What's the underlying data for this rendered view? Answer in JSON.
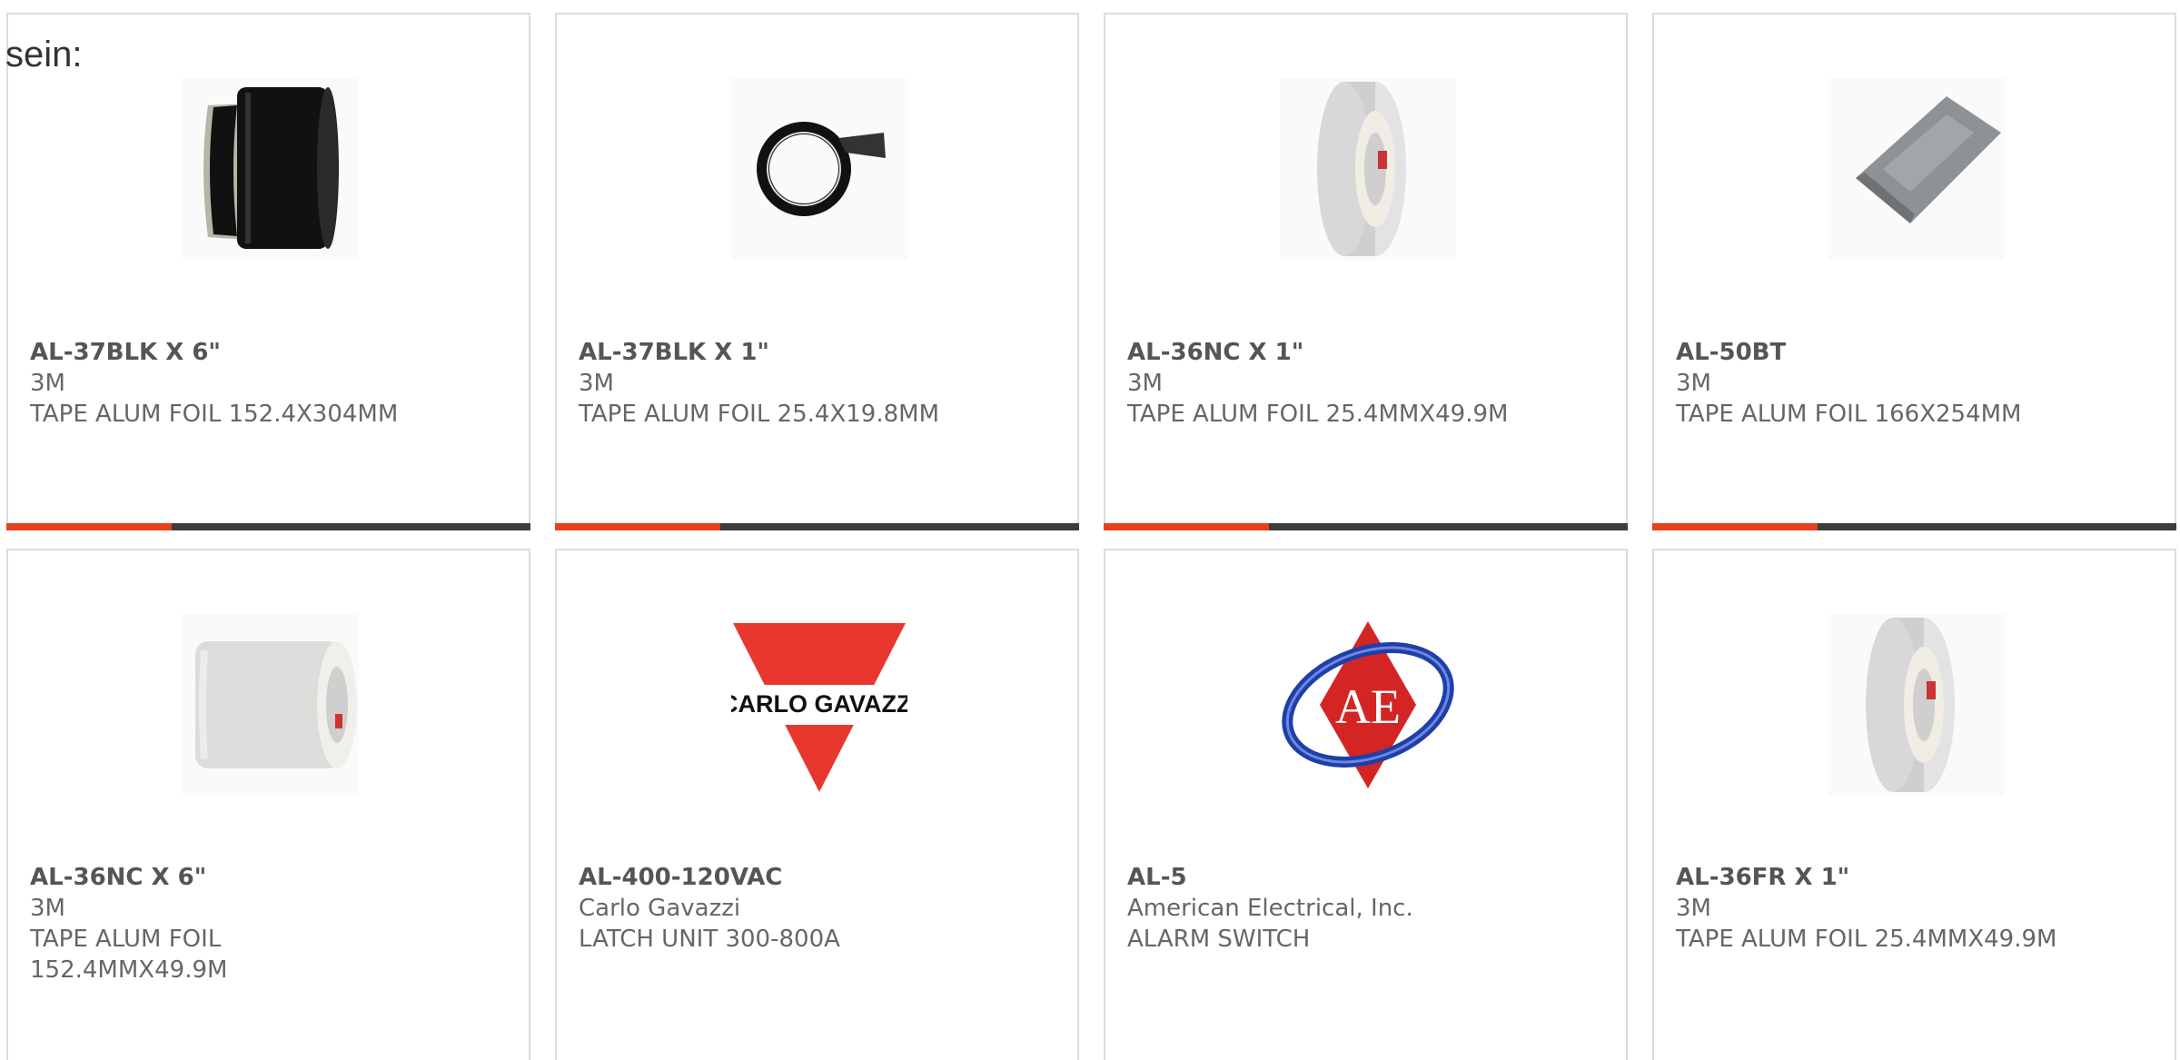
{
  "intro_text": "sein:",
  "colors": {
    "accent": "#e8401c",
    "bar": "#3d3d3d",
    "card_border": "#dcdcdc",
    "text": "#666666"
  },
  "products": [
    {
      "part": "AL-37BLK X 6\"",
      "manufacturer": "3M",
      "description": "TAPE ALUM FOIL 152.4X304MM",
      "image": "black-foil-roll-image"
    },
    {
      "part": "AL-37BLK X 1\"",
      "manufacturer": "3M",
      "description": "TAPE ALUM FOIL 25.4X19.8MM",
      "image": "black-tape-ring-image"
    },
    {
      "part": "AL-36NC X 1\"",
      "manufacturer": "3M",
      "description": "TAPE ALUM FOIL 25.4MMX49.9M",
      "image": "silver-tape-roll-image"
    },
    {
      "part": "AL-50BT",
      "manufacturer": "3M",
      "description": "TAPE ALUM FOIL 166X254MM",
      "image": "foil-sheet-image"
    },
    {
      "part": "AL-36NC X 6\"",
      "manufacturer": "3M",
      "description": "TAPE ALUM FOIL 152.4MMX49.9M",
      "image": "wide-foil-roll-image"
    },
    {
      "part": "AL-400-120VAC",
      "manufacturer": "Carlo Gavazzi",
      "description": "LATCH UNIT 300-800A",
      "image": "carlo-gavazzi-logo",
      "logo_text": "CARLO GAVAZZI"
    },
    {
      "part": "AL-5",
      "manufacturer": "American Electrical, Inc.",
      "description": "ALARM SWITCH",
      "image": "american-electrical-logo",
      "logo_text": "AE"
    },
    {
      "part": "AL-36FR X 1\"",
      "manufacturer": "3M",
      "description": "TAPE ALUM FOIL 25.4MMX49.9M",
      "image": "silver-tape-roll-image"
    }
  ]
}
